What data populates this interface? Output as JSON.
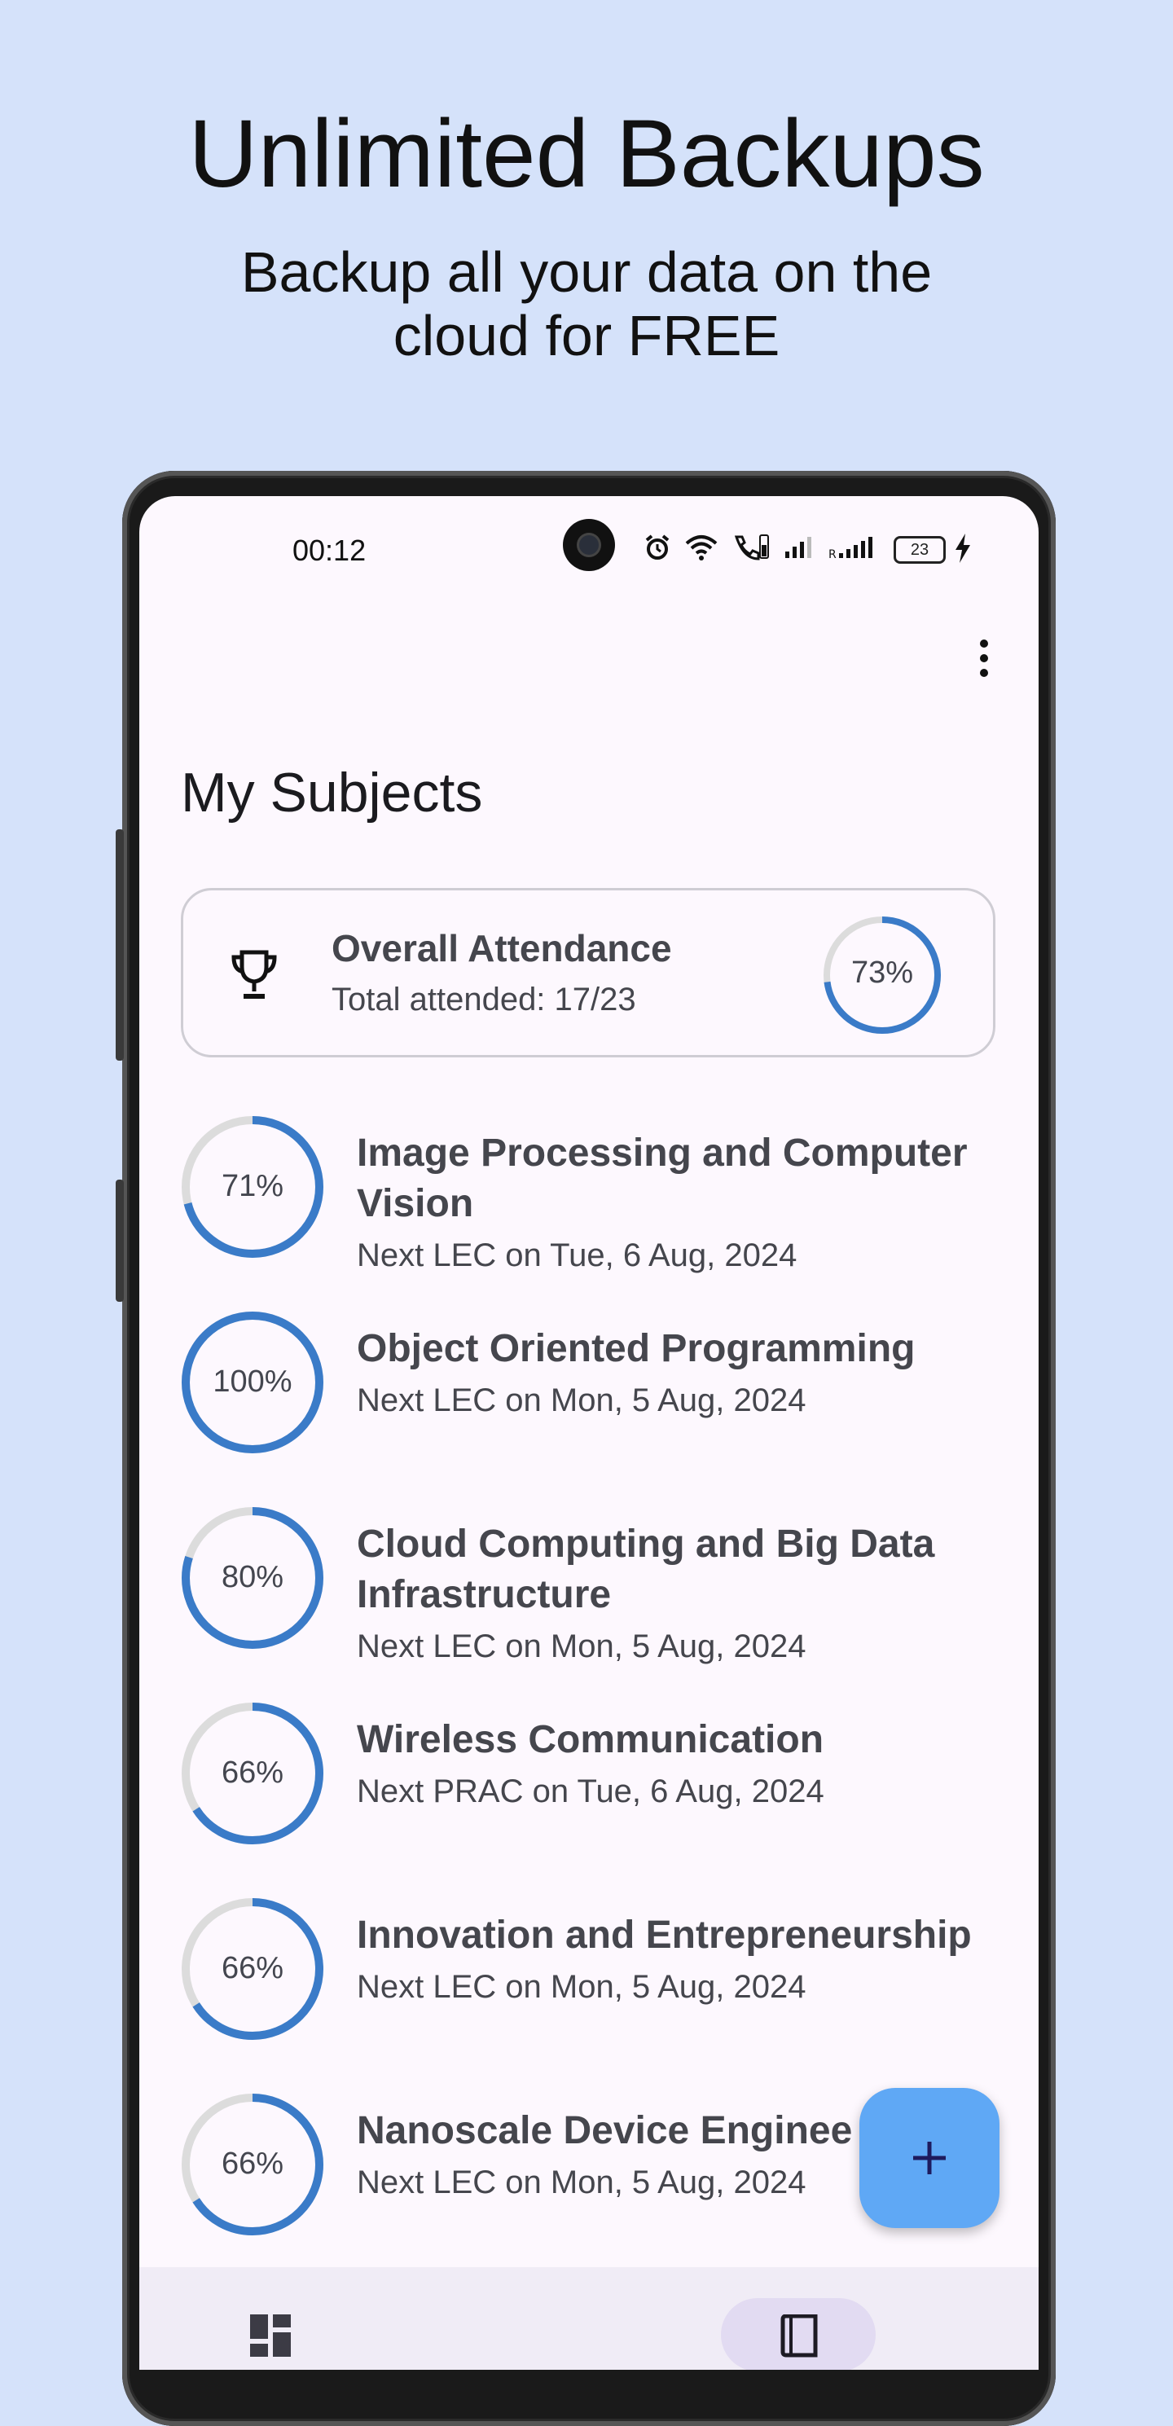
{
  "promo": {
    "title": "Unlimited Backups",
    "subtitle": "Backup all your data on the cloud for FREE"
  },
  "status_bar": {
    "time": "00:12",
    "battery": "23",
    "icons": [
      "alarm-icon",
      "wifi-icon",
      "wifi-calling-icon",
      "signal-icon",
      "roaming-signal-icon",
      "battery-icon",
      "charging-icon"
    ]
  },
  "page": {
    "title": "My Subjects",
    "menu_icon": "more-vert-icon"
  },
  "overall": {
    "icon": "trophy-icon",
    "title": "Overall Attendance",
    "subtitle": "Total attended: 17/23",
    "percent_label": "73%",
    "fraction": 0.73
  },
  "subjects": [
    {
      "name": "Image Processing and Computer Vision",
      "next": "Next LEC on Tue, 6 Aug, 2024",
      "percent_label": "71%",
      "fraction": 0.71
    },
    {
      "name": "Object Oriented Programming",
      "next": "Next LEC on Mon, 5 Aug, 2024",
      "percent_label": "100%",
      "fraction": 1.0
    },
    {
      "name": "Cloud Computing and Big Data Infrastructure",
      "next": "Next LEC on Mon, 5 Aug, 2024",
      "percent_label": "80%",
      "fraction": 0.8
    },
    {
      "name": "Wireless Communication",
      "next": "Next PRAC on Tue, 6 Aug, 2024",
      "percent_label": "66%",
      "fraction": 0.66
    },
    {
      "name": "Innovation and Entrepreneurship",
      "next": "Next LEC on Mon, 5 Aug, 2024",
      "percent_label": "66%",
      "fraction": 0.66
    },
    {
      "name": "Nanoscale Device Enginee",
      "next": "Next LEC on Mon, 5 Aug, 2024",
      "percent_label": "66%",
      "fraction": 0.66
    }
  ],
  "fab": {
    "icon": "plus-icon"
  },
  "bottom_nav": {
    "items": [
      {
        "icon": "dashboard-icon"
      },
      {
        "icon": "book-icon"
      }
    ]
  },
  "colors": {
    "accent": "#3a7bc8",
    "ring_track": "#dcdcdc",
    "fab": "#5fa8f5",
    "background": "#d5e2fa"
  }
}
